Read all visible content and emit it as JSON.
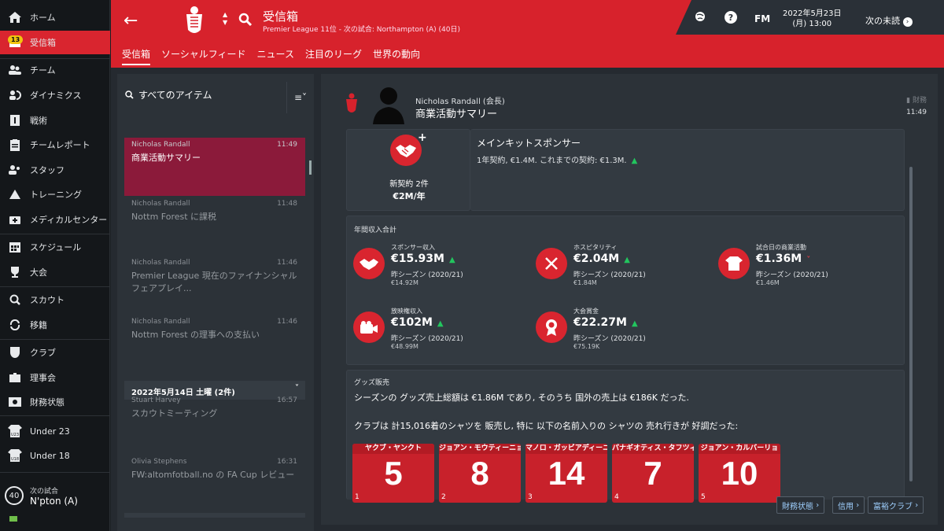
{
  "sidebar": {
    "items": [
      {
        "label": "ホーム",
        "icon": "home-icon"
      },
      {
        "label": "受信箱",
        "icon": "inbox-icon",
        "badge": "13"
      },
      {
        "label": "チーム",
        "icon": "team-icon"
      },
      {
        "label": "ダイナミクス",
        "icon": "dynamics-icon"
      },
      {
        "label": "戦術",
        "icon": "tactics-icon"
      },
      {
        "label": "チームレポート",
        "icon": "report-icon"
      },
      {
        "label": "スタッフ",
        "icon": "staff-icon"
      },
      {
        "label": "トレーニング",
        "icon": "training-icon"
      },
      {
        "label": "メディカルセンター",
        "icon": "medical-icon"
      },
      {
        "label": "スケジュール",
        "icon": "calendar-icon"
      },
      {
        "label": "大会",
        "icon": "trophy-icon"
      },
      {
        "label": "スカウト",
        "icon": "scout-icon"
      },
      {
        "label": "移籍",
        "icon": "transfer-icon"
      },
      {
        "label": "クラブ",
        "icon": "club-icon"
      },
      {
        "label": "理事会",
        "icon": "board-icon"
      },
      {
        "label": "財務状態",
        "icon": "finance-icon"
      },
      {
        "label": "Under 23",
        "icon": "u23-icon"
      },
      {
        "label": "Under 18",
        "icon": "u18-icon"
      }
    ],
    "next_match": {
      "label": "次の試合",
      "value": "N'pton (A)",
      "days": "40"
    }
  },
  "header": {
    "title": "受信箱",
    "subtitle": "Premier League 11位 - 次の試合: Northampton (A) (40日)",
    "tabs": [
      "受信箱",
      "ソーシャルフィード",
      "ニュース",
      "注目のリーグ",
      "世界の動向"
    ],
    "fm": "FM",
    "date": "2022年5月23日",
    "time": "(月) 13:00",
    "next_unread": "次の未読"
  },
  "inbox": {
    "search_label": "すべてのアイテム",
    "messages": [
      {
        "from": "Nicholas Randall",
        "time": "11:49",
        "subject": "商業活動サマリー"
      },
      {
        "from": "Nicholas Randall",
        "time": "11:48",
        "subject": "Nottm Forest に課税"
      },
      {
        "from": "Nicholas Randall",
        "time": "11:46",
        "subject": "Premier League 現在のファイナンシャルフェアプレイ..."
      },
      {
        "from": "Nicholas Randall",
        "time": "11:46",
        "subject": "Nottm Forest の理事への支払い"
      },
      {
        "from": "Stuart Harvey",
        "time": "16:57",
        "subject": "スカウトミーティング"
      },
      {
        "from": "Olivia Stephens",
        "time": "16:31",
        "subject": "FW:altomfotball.no の FA Cup レビュー"
      }
    ],
    "date_header": "2022年5月14日 土曜 (2件)"
  },
  "detail": {
    "from": "Nicholas Randall (会長)",
    "subject": "商業活動サマリー",
    "tag": "財務",
    "time": "11:49",
    "new_contracts": "新契約 2件",
    "new_contracts_value": "€2M/年",
    "sponsor_title": "メインキットスポンサー",
    "sponsor_text": "1年契約, €1.4M. これまでの契約: €1.3M.",
    "annual_label": "年間収入合計",
    "stats": [
      {
        "label": "スポンサー収入",
        "value": "€15.93M",
        "trend": "up",
        "prev_label": "昨シーズン (2020/21)",
        "prev_value": "€14.92M",
        "icon": "handshake-icon"
      },
      {
        "label": "ホスピタリティ",
        "value": "€2.04M",
        "trend": "up",
        "prev_label": "昨シーズン (2020/21)",
        "prev_value": "€1.84M",
        "icon": "cutlery-icon"
      },
      {
        "label": "試合日の商業活動",
        "value": "€1.36M",
        "trend": "down",
        "prev_label": "昨シーズン (2020/21)",
        "prev_value": "€1.46M",
        "icon": "shirt-icon"
      },
      {
        "label": "放映権収入",
        "value": "€102M",
        "trend": "up",
        "prev_label": "昨シーズン (2020/21)",
        "prev_value": "€48.99M",
        "icon": "camera-icon"
      },
      {
        "label": "大会賞金",
        "value": "€22.27M",
        "trend": "up",
        "prev_label": "昨シーズン (2020/21)",
        "prev_value": "€75.19K",
        "icon": "medal-icon"
      }
    ],
    "merch_label": "グッズ販売",
    "merch_text1": "シーズンの グッズ売上総額は €1.86M であり, そのうち 国外の売上は €186K だった.",
    "merch_text2": "クラブは 計15,016着のシャツを 販売し, 特に 以下の名前入りの シャツの 売れ行きが 好調だった:",
    "shirts": [
      {
        "name": "ヤクブ・ヤンクト",
        "number": "5",
        "rank": "1"
      },
      {
        "name": "ジョアン・モウティーニョ",
        "number": "8",
        "rank": "2"
      },
      {
        "name": "マノロ・ガッビアディーニ",
        "number": "14",
        "rank": "3"
      },
      {
        "name": "パナギオティス・タフツィ…",
        "number": "7",
        "rank": "4"
      },
      {
        "name": "ジョアン・カルバーリョ",
        "number": "10",
        "rank": "5"
      }
    ],
    "footer_buttons": [
      "財務状態",
      "信用",
      "富裕クラブ"
    ]
  },
  "colors": {
    "accent": "#d7222c",
    "up": "#22c55e",
    "down": "#e23a45"
  }
}
